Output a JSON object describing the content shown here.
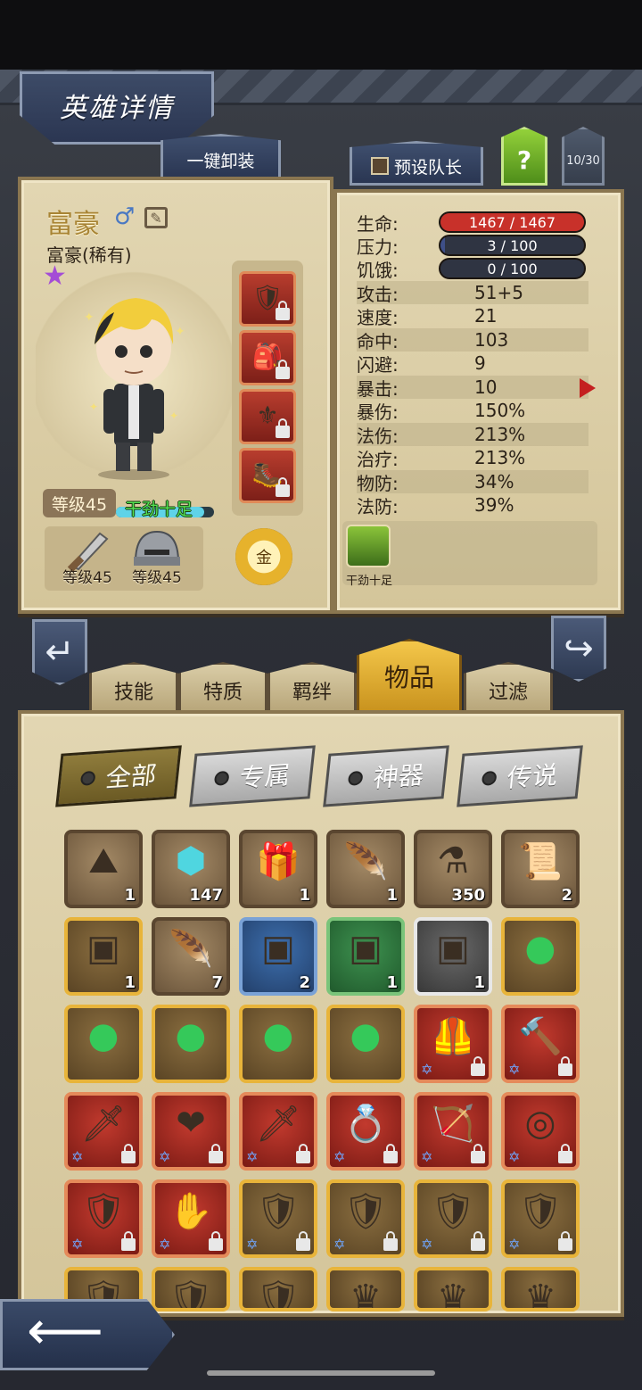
{
  "header": {
    "title": "英雄详情",
    "unequip_label": "一键卸装",
    "preset_leader_label": "预设队长",
    "help_label": "?",
    "hero_count": "10/30"
  },
  "hero": {
    "name": "富豪",
    "class_rarity": "富豪(稀有)",
    "level": "等级45",
    "mood": "干劲十足",
    "mood_fill": 0.9,
    "weapon_level": "等级45",
    "armor_level": "等级45",
    "gold_label": "金"
  },
  "stats": {
    "hp_label": "生命:",
    "hp_value": "1467 / 1467",
    "hp_fill": 1.0,
    "stress_label": "压力:",
    "stress_value": "3 / 100",
    "stress_fill": 0.03,
    "hunger_label": "饥饿:",
    "hunger_value": "0 / 100",
    "hunger_fill": 0.0,
    "rows": [
      {
        "label": "攻击:",
        "value": "51+5"
      },
      {
        "label": "速度:",
        "value": "21"
      },
      {
        "label": "命中:",
        "value": "103"
      },
      {
        "label": "闪避:",
        "value": "9"
      },
      {
        "label": "暴击:",
        "value": "10"
      },
      {
        "label": "暴伤:",
        "value": "150%"
      },
      {
        "label": "法伤:",
        "value": "213%"
      },
      {
        "label": "治疗:",
        "value": "213%"
      },
      {
        "label": "物防:",
        "value": "34%"
      },
      {
        "label": "法防:",
        "value": "39%"
      }
    ],
    "trait_label": "干劲十足"
  },
  "tabs": [
    "技能",
    "特质",
    "羁绊",
    "物品",
    "过滤"
  ],
  "active_tab": "物品",
  "filters": [
    "全部",
    "专属",
    "神器",
    "传说"
  ],
  "active_filter": "全部",
  "items": [
    {
      "icon": "sand-pile-icon",
      "rarity": "brown",
      "count": "1"
    },
    {
      "icon": "cyan-rune-stone-icon",
      "rarity": "brown",
      "count": "147"
    },
    {
      "icon": "red-treasure-box-icon",
      "rarity": "brown",
      "count": "1"
    },
    {
      "icon": "golden-feather-icon",
      "rarity": "brown",
      "count": "1"
    },
    {
      "icon": "blue-potion-icon",
      "rarity": "brown",
      "count": "350"
    },
    {
      "icon": "golden-scroll-icon",
      "rarity": "brown",
      "count": "2"
    },
    {
      "icon": "gold-chest-icon",
      "rarity": "gold",
      "count": "1"
    },
    {
      "icon": "white-feather-icon",
      "rarity": "brown",
      "count": "7"
    },
    {
      "icon": "blue-chest-icon",
      "rarity": "blue",
      "count": "2"
    },
    {
      "icon": "green-chest-icon",
      "rarity": "green",
      "count": "1"
    },
    {
      "icon": "white-chest-icon",
      "rarity": "white",
      "count": "1"
    },
    {
      "icon": "green-gem-icon",
      "rarity": "gold",
      "count": ""
    },
    {
      "icon": "green-gem-icon",
      "rarity": "gold",
      "count": ""
    },
    {
      "icon": "green-gem-icon",
      "rarity": "gold",
      "count": ""
    },
    {
      "icon": "green-gem-icon",
      "rarity": "gold",
      "count": ""
    },
    {
      "icon": "green-gem-icon",
      "rarity": "gold",
      "count": ""
    },
    {
      "icon": "red-armor-icon",
      "rarity": "red",
      "count": "",
      "locked": true
    },
    {
      "icon": "hammer-icon",
      "rarity": "red",
      "count": "",
      "locked": true
    },
    {
      "icon": "crimson-blade-icon",
      "rarity": "red",
      "count": "",
      "locked": true
    },
    {
      "icon": "flame-heart-icon",
      "rarity": "red",
      "count": "",
      "locked": true
    },
    {
      "icon": "green-dagger-icon",
      "rarity": "red",
      "count": "",
      "locked": true
    },
    {
      "icon": "jeweled-ring-icon",
      "rarity": "red",
      "count": "",
      "locked": true
    },
    {
      "icon": "golden-crossbow-icon",
      "rarity": "red",
      "count": "",
      "locked": true
    },
    {
      "icon": "orb-ring-icon",
      "rarity": "red",
      "count": "",
      "locked": true
    },
    {
      "icon": "rune-shield-icon",
      "rarity": "red",
      "count": "",
      "locked": true
    },
    {
      "icon": "claw-gauntlet-icon",
      "rarity": "red",
      "count": "",
      "locked": true
    },
    {
      "icon": "shield-icon",
      "rarity": "gold",
      "count": "",
      "locked": true
    },
    {
      "icon": "shield-icon",
      "rarity": "gold",
      "count": "",
      "locked": true
    },
    {
      "icon": "shield-icon",
      "rarity": "gold",
      "count": "",
      "locked": true
    },
    {
      "icon": "shield-icon",
      "rarity": "gold",
      "count": "",
      "locked": true
    },
    {
      "icon": "shield-icon",
      "rarity": "gold",
      "count": ""
    },
    {
      "icon": "shield-icon",
      "rarity": "gold",
      "count": ""
    },
    {
      "icon": "shield-icon",
      "rarity": "gold",
      "count": ""
    },
    {
      "icon": "crystal-crown-icon",
      "rarity": "gold",
      "count": ""
    },
    {
      "icon": "crystal-crown-icon",
      "rarity": "gold",
      "count": ""
    },
    {
      "icon": "crystal-crown-icon",
      "rarity": "gold",
      "count": ""
    }
  ],
  "colors": {
    "hp_bar": "#c8312a",
    "stress_bar": "#3e4f88",
    "mood_bar": "#5fd3e8",
    "active_tab": "#f4c74a"
  }
}
